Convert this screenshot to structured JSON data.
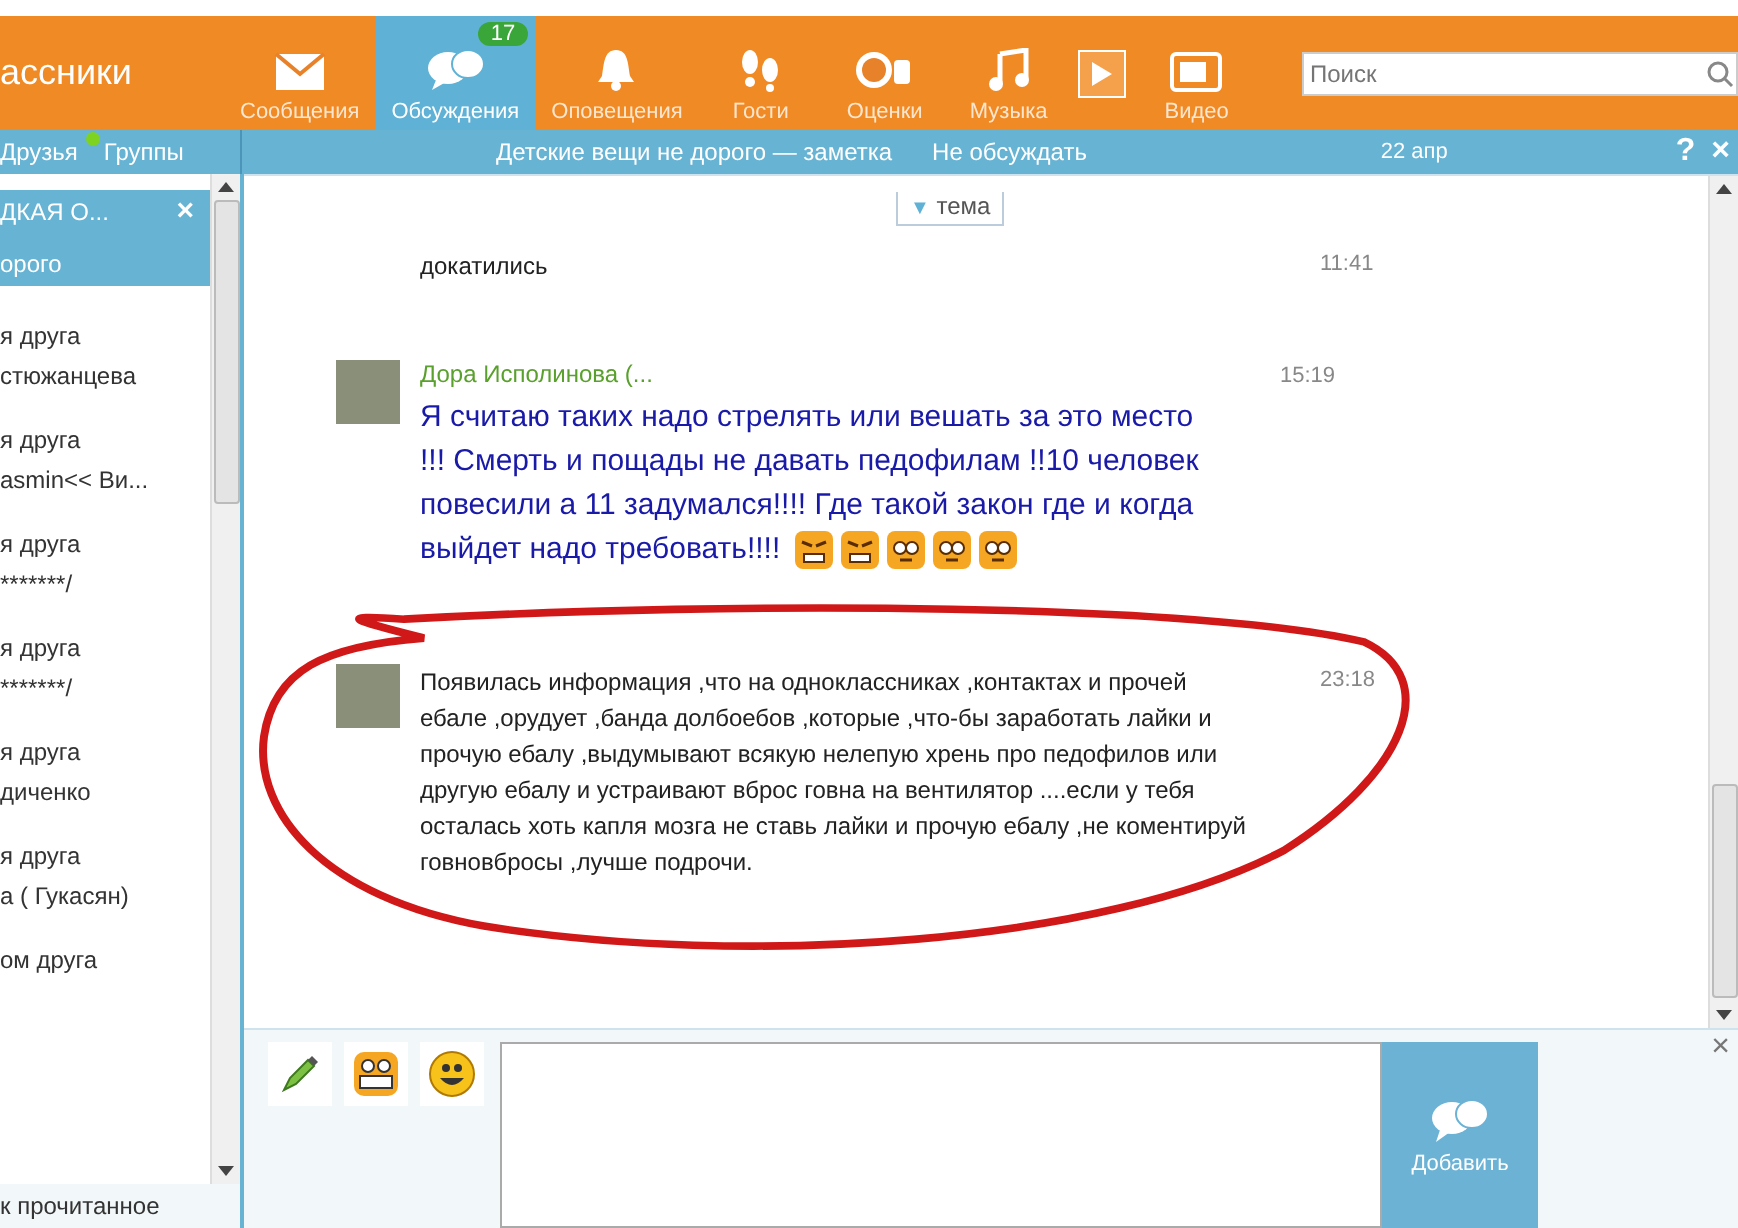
{
  "logo": "ассники",
  "nav": [
    {
      "label": "Сообщения",
      "kind": "envelope",
      "selected": false
    },
    {
      "label": "Обсуждения",
      "kind": "bubbles",
      "selected": true,
      "badge": "17"
    },
    {
      "label": "Оповещения",
      "kind": "bell",
      "selected": false
    },
    {
      "label": "Гости",
      "kind": "feet",
      "selected": false
    },
    {
      "label": "Оценки",
      "kind": "rating",
      "selected": false
    },
    {
      "label": "Музыка",
      "kind": "note",
      "selected": false
    },
    {
      "label": "Видео",
      "kind": "tv",
      "selected": false
    }
  ],
  "search": {
    "placeholder": "Поиск"
  },
  "subbar": {
    "friends": "Друзья",
    "friends_online": true,
    "groups": "Группы",
    "title": "Детские вещи не дорого — заметка",
    "mute": "Не обсуждать",
    "date": "22 апр",
    "help": "?",
    "close": "×"
  },
  "sidebar": {
    "items": [
      {
        "line1": "ДКАЯ О...",
        "line2": "орого",
        "selected": true,
        "close": "×"
      },
      {
        "line1": "я друга",
        "line2": "стюжанцева",
        "selected": false
      },
      {
        "line1": "я друга",
        "line2": "asmin<< Ви...",
        "selected": false
      },
      {
        "line1": "я друга",
        "line2": "*******/",
        "selected": false
      },
      {
        "line1": "я друга",
        "line2": "*******/",
        "selected": false
      },
      {
        "line1": "я друга",
        "line2": "диченко",
        "selected": false
      },
      {
        "line1": "я друга",
        "line2": "а ( Гукасян)",
        "selected": false
      },
      {
        "line1": "ом друга",
        "selected": false
      }
    ],
    "footer": "к прочитанное"
  },
  "topic_tab": {
    "arrow": "▼",
    "label": "тема"
  },
  "messages": [
    {
      "kind": "plain",
      "text": "докатились",
      "time": "11:41",
      "avatar": false,
      "circled": false
    },
    {
      "kind": "big",
      "author": "Дора Исполинова (...",
      "text": "Я считаю таких надо стрелять или вешать  за это место  !!!     Смерть и пощады не давать педофилам !!10 человек повесили а 11 задумался!!!!  Где такой закон где и когда  выйдет надо требовать!!!!",
      "emoticons": [
        {
          "kind": "angry"
        },
        {
          "kind": "angry"
        },
        {
          "kind": "worried"
        },
        {
          "kind": "worried"
        },
        {
          "kind": "worried"
        }
      ],
      "time": "15:19",
      "avatar": true,
      "circled": false
    },
    {
      "kind": "plain",
      "text": "Появилась информация ,что на одноклассниках ,контактах и прочей ебале ,орудует ,банда долбоебов ,которые ,что-бы заработать лайки и прочую ебалу ,выдумывают всякую нелепую хрень про педофилов или другую ебалу и устраивают вброс говна на вентилятор ....если у тебя осталась хоть капля мозга не ставь лайки и прочую ебалу ,не коментируй говновбросы ,лучше подрочи.",
      "time": "23:18",
      "avatar": true,
      "circled": true
    }
  ],
  "composer": {
    "tools": [
      {
        "kind": "pencil"
      },
      {
        "kind": "grin"
      },
      {
        "kind": "smile"
      }
    ],
    "send": "Добавить",
    "close": "×"
  }
}
